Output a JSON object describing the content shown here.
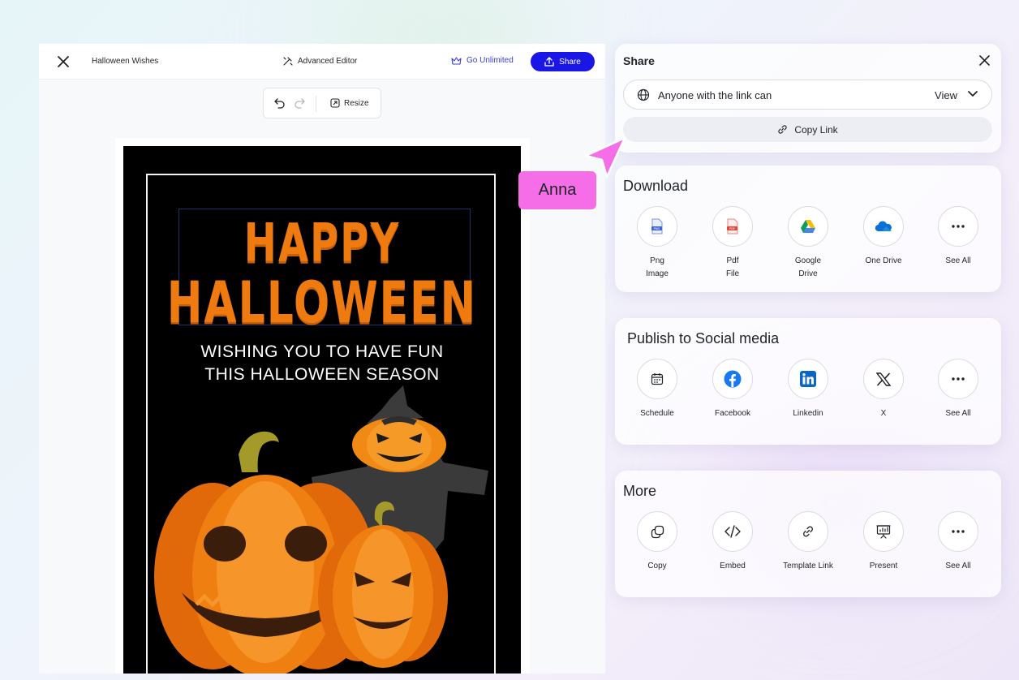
{
  "editor": {
    "doc_title": "Halloween Wishes",
    "advanced_editor_label": "Advanced Editor",
    "go_unlimited_label": "Go Unlimited",
    "share_label": "Share",
    "resize_label": "Resize"
  },
  "card": {
    "headline_1": "HAPPY",
    "headline_2": "HALLOWEEN",
    "wish_line_1": "WISHING YOU TO HAVE FUN",
    "wish_line_2": "THIS HALLOWEEN SEASON"
  },
  "collaborator": {
    "name": "Anna",
    "color": "#f56ee8"
  },
  "share_panel": {
    "title": "Share",
    "link_access_text": "Anyone with the link can",
    "link_access_value": "View",
    "copy_link_label": "Copy Link"
  },
  "download": {
    "title": "Download",
    "items": [
      {
        "line1": "Png",
        "line2": "Image",
        "icon": "png-file-icon"
      },
      {
        "line1": "Pdf",
        "line2": "File",
        "icon": "pdf-file-icon"
      },
      {
        "line1": "Google",
        "line2": "Drive",
        "icon": "google-drive-icon"
      },
      {
        "line1": "One Drive",
        "line2": "",
        "icon": "onedrive-icon"
      },
      {
        "line1": "See All",
        "line2": "",
        "icon": "more-dots-icon"
      }
    ]
  },
  "social": {
    "title": "Publish to Social media",
    "items": [
      {
        "label": "Schedule",
        "icon": "calendar-icon"
      },
      {
        "label": "Facebook",
        "icon": "facebook-icon"
      },
      {
        "label": "Linkedin",
        "icon": "linkedin-icon"
      },
      {
        "label": "X",
        "icon": "x-logo-icon"
      },
      {
        "label": "See All",
        "icon": "more-dots-icon"
      }
    ]
  },
  "more": {
    "title": "More",
    "items": [
      {
        "label": "Copy",
        "icon": "copy-icon"
      },
      {
        "label": "Embed",
        "icon": "code-icon"
      },
      {
        "label": "Template Link",
        "icon": "link-icon"
      },
      {
        "label": "Present",
        "icon": "presentation-icon"
      },
      {
        "label": "See All",
        "icon": "more-dots-icon"
      }
    ]
  },
  "colors": {
    "primary": "#1a16e6",
    "accent_orange": "#ee7a10",
    "facebook": "#1877f2",
    "linkedin": "#0a66c2"
  }
}
